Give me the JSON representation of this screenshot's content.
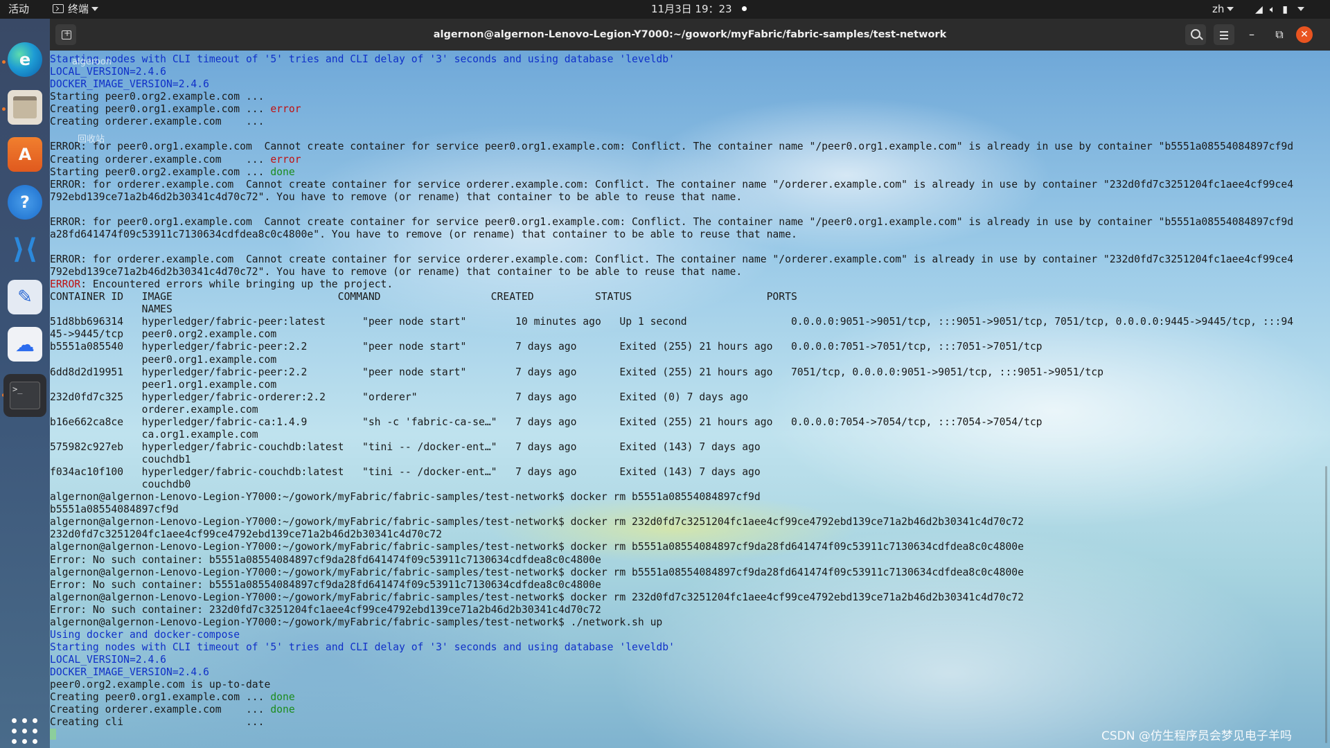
{
  "topbar": {
    "activities": "活动",
    "app_menu": "终端",
    "clock": "11月3日  19：23",
    "lang": "zh"
  },
  "dock": {
    "items": [
      "edge",
      "files",
      "ubuntu-software",
      "help",
      "vscode",
      "text-editor",
      "baidu-netdisk",
      "terminal",
      "show-apps"
    ],
    "terminal_glyph": ">_"
  },
  "desktop": {
    "label1": "algeroon",
    "label2": "回收站"
  },
  "window": {
    "title": "algernon@algernon-Lenovo-Legion-Y7000:~/gowork/myFabric/fabric-samples/test-network"
  },
  "terminal": {
    "lines": [
      [
        [
          "b",
          "Starting nodes with CLI timeout of '5' tries and CLI delay of '3' seconds and using database 'leveldb'"
        ]
      ],
      [
        [
          "b",
          "LOCAL_VERSION=2.4.6"
        ]
      ],
      [
        [
          "b",
          "DOCKER_IMAGE_VERSION=2.4.6"
        ]
      ],
      [
        [
          "n",
          "Starting peer0.org2.example.com ..."
        ]
      ],
      [
        [
          "n",
          "Creating peer0.org1.example.com ... "
        ],
        [
          "r",
          "error"
        ]
      ],
      [
        [
          "n",
          "Creating orderer.example.com    ..."
        ]
      ],
      [
        [
          "n",
          ""
        ]
      ],
      [
        [
          "n",
          "ERROR: for peer0.org1.example.com  Cannot create container for service peer0.org1.example.com: Conflict. The container name \"/peer0.org1.example.com\" is already in use by container \"b5551a08554084897cf9d"
        ]
      ],
      [
        [
          "n",
          "Creating orderer.example.com    ... "
        ],
        [
          "r",
          "error"
        ]
      ],
      [
        [
          "n",
          "Starting peer0.org2.example.com ... "
        ],
        [
          "g",
          "done"
        ]
      ],
      [
        [
          "n",
          "ERROR: for orderer.example.com  Cannot create container for service orderer.example.com: Conflict. The container name \"/orderer.example.com\" is already in use by container \"232d0fd7c3251204fc1aee4cf99ce4"
        ]
      ],
      [
        [
          "n",
          "792ebd139ce71a2b46d2b30341c4d70c72\". You have to remove (or rename) that container to be able to reuse that name."
        ]
      ],
      [
        [
          "n",
          ""
        ]
      ],
      [
        [
          "n",
          "ERROR: for peer0.org1.example.com  Cannot create container for service peer0.org1.example.com: Conflict. The container name \"/peer0.org1.example.com\" is already in use by container \"b5551a08554084897cf9d"
        ]
      ],
      [
        [
          "n",
          "a28fd641474f09c53911c7130634cdfdea8c0c4800e\". You have to remove (or rename) that container to be able to reuse that name."
        ]
      ],
      [
        [
          "n",
          ""
        ]
      ],
      [
        [
          "n",
          "ERROR: for orderer.example.com  Cannot create container for service orderer.example.com: Conflict. The container name \"/orderer.example.com\" is already in use by container \"232d0fd7c3251204fc1aee4cf99ce4"
        ]
      ],
      [
        [
          "n",
          "792ebd139ce71a2b46d2b30341c4d70c72\". You have to remove (or rename) that container to be able to reuse that name."
        ]
      ],
      [
        [
          "r",
          "ERROR"
        ],
        [
          "n",
          ": Encountered errors while bringing up the project."
        ]
      ],
      [
        [
          "n",
          "CONTAINER ID   IMAGE                           COMMAND                  CREATED          STATUS                      PORTS"
        ]
      ],
      [
        [
          "n",
          "               NAMES"
        ]
      ],
      [
        [
          "n",
          "51d8bb696314   hyperledger/fabric-peer:latest      \"peer node start\"        10 minutes ago   Up 1 second                 0.0.0.0:9051->9051/tcp, :::9051->9051/tcp, 7051/tcp, 0.0.0.0:9445->9445/tcp, :::94"
        ]
      ],
      [
        [
          "n",
          "45->9445/tcp   peer0.org2.example.com"
        ]
      ],
      [
        [
          "n",
          "b5551a085540   hyperledger/fabric-peer:2.2         \"peer node start\"        7 days ago       Exited (255) 21 hours ago   0.0.0.0:7051->7051/tcp, :::7051->7051/tcp"
        ]
      ],
      [
        [
          "n",
          "               peer0.org1.example.com"
        ]
      ],
      [
        [
          "n",
          "6dd8d2d19951   hyperledger/fabric-peer:2.2         \"peer node start\"        7 days ago       Exited (255) 21 hours ago   7051/tcp, 0.0.0.0:9051->9051/tcp, :::9051->9051/tcp"
        ]
      ],
      [
        [
          "n",
          "               peer1.org1.example.com"
        ]
      ],
      [
        [
          "n",
          "232d0fd7c325   hyperledger/fabric-orderer:2.2      \"orderer\"                7 days ago       Exited (0) 7 days ago"
        ]
      ],
      [
        [
          "n",
          "               orderer.example.com"
        ]
      ],
      [
        [
          "n",
          "b16e662ca8ce   hyperledger/fabric-ca:1.4.9         \"sh -c 'fabric-ca-se…\"   7 days ago       Exited (255) 21 hours ago   0.0.0.0:7054->7054/tcp, :::7054->7054/tcp"
        ]
      ],
      [
        [
          "n",
          "               ca.org1.example.com"
        ]
      ],
      [
        [
          "n",
          "575982c927eb   hyperledger/fabric-couchdb:latest   \"tini -- /docker-ent…\"   7 days ago       Exited (143) 7 days ago"
        ]
      ],
      [
        [
          "n",
          "               couchdb1"
        ]
      ],
      [
        [
          "n",
          "f034ac10f100   hyperledger/fabric-couchdb:latest   \"tini -- /docker-ent…\"   7 days ago       Exited (143) 7 days ago"
        ]
      ],
      [
        [
          "n",
          "               couchdb0"
        ]
      ],
      [
        [
          "n",
          "algernon@algernon-Lenovo-Legion-Y7000:~/gowork/myFabric/fabric-samples/test-network$ docker rm b5551a08554084897cf9d"
        ]
      ],
      [
        [
          "n",
          "b5551a08554084897cf9d"
        ]
      ],
      [
        [
          "n",
          "algernon@algernon-Lenovo-Legion-Y7000:~/gowork/myFabric/fabric-samples/test-network$ docker rm 232d0fd7c3251204fc1aee4cf99ce4792ebd139ce71a2b46d2b30341c4d70c72"
        ]
      ],
      [
        [
          "n",
          "232d0fd7c3251204fc1aee4cf99ce4792ebd139ce71a2b46d2b30341c4d70c72"
        ]
      ],
      [
        [
          "n",
          "algernon@algernon-Lenovo-Legion-Y7000:~/gowork/myFabric/fabric-samples/test-network$ docker rm b5551a08554084897cf9da28fd641474f09c53911c7130634cdfdea8c0c4800e"
        ]
      ],
      [
        [
          "n",
          "Error: No such container: b5551a08554084897cf9da28fd641474f09c53911c7130634cdfdea8c0c4800e"
        ]
      ],
      [
        [
          "n",
          "algernon@algernon-Lenovo-Legion-Y7000:~/gowork/myFabric/fabric-samples/test-network$ docker rm b5551a08554084897cf9da28fd641474f09c53911c7130634cdfdea8c0c4800e"
        ]
      ],
      [
        [
          "n",
          "Error: No such container: b5551a08554084897cf9da28fd641474f09c53911c7130634cdfdea8c0c4800e"
        ]
      ],
      [
        [
          "n",
          "algernon@algernon-Lenovo-Legion-Y7000:~/gowork/myFabric/fabric-samples/test-network$ docker rm 232d0fd7c3251204fc1aee4cf99ce4792ebd139ce71a2b46d2b30341c4d70c72"
        ]
      ],
      [
        [
          "n",
          "Error: No such container: 232d0fd7c3251204fc1aee4cf99ce4792ebd139ce71a2b46d2b30341c4d70c72"
        ]
      ],
      [
        [
          "n",
          "algernon@algernon-Lenovo-Legion-Y7000:~/gowork/myFabric/fabric-samples/test-network$ ./network.sh up"
        ]
      ],
      [
        [
          "b",
          "Using docker and docker-compose"
        ]
      ],
      [
        [
          "b",
          "Starting nodes with CLI timeout of '5' tries and CLI delay of '3' seconds and using database 'leveldb'"
        ]
      ],
      [
        [
          "b",
          "LOCAL_VERSION=2.4.6"
        ]
      ],
      [
        [
          "b",
          "DOCKER_IMAGE_VERSION=2.4.6"
        ]
      ],
      [
        [
          "n",
          "peer0.org2.example.com is up-to-date"
        ]
      ],
      [
        [
          "n",
          "Creating peer0.org1.example.com ... "
        ],
        [
          "g",
          "done"
        ]
      ],
      [
        [
          "n",
          "Creating orderer.example.com    ... "
        ],
        [
          "g",
          "done"
        ]
      ],
      [
        [
          "n",
          "Creating cli                    ..."
        ]
      ]
    ]
  },
  "watermark": "CSDN @仿生程序员会梦见电子羊吗",
  "colors": {
    "topbar_bg": "#1d1d1d",
    "titlebar_bg": "#2c2c2c",
    "close_btn": "#e95420",
    "text_blue": "#1030c8",
    "text_red": "#c01010",
    "text_green": "#1c8c1c"
  }
}
